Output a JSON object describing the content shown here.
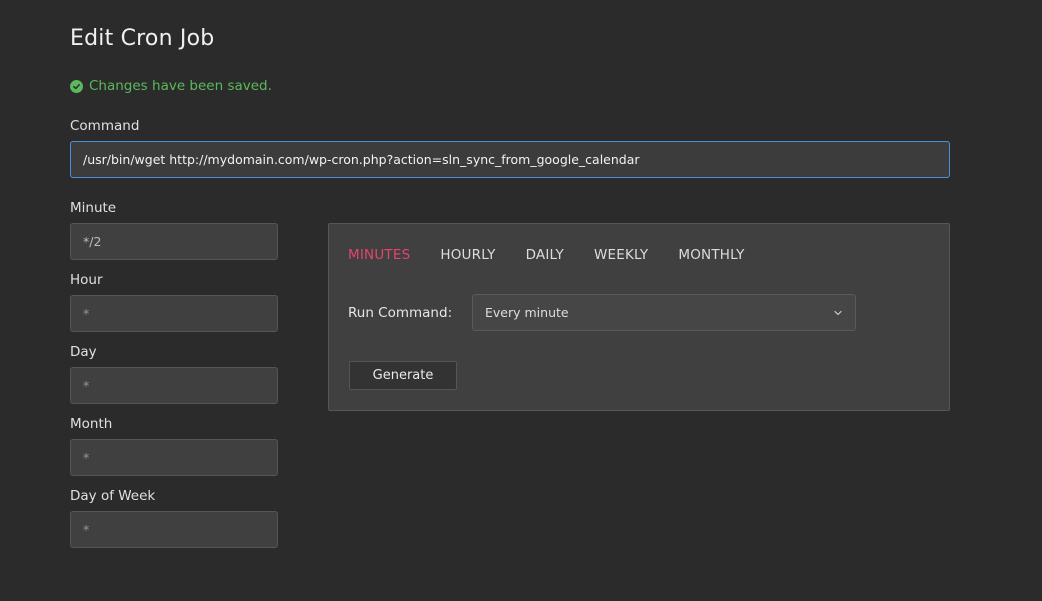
{
  "page": {
    "title": "Edit Cron Job"
  },
  "notice": {
    "text": "Changes have been saved.",
    "color": "#5cb85c",
    "icon": "check-circle-icon"
  },
  "command": {
    "label": "Command",
    "value": "/usr/bin/wget http://mydomain.com/wp-cron.php?action=sln_sync_from_google_calendar"
  },
  "fields": {
    "minute": {
      "label": "Minute",
      "value": "*/2"
    },
    "hour": {
      "label": "Hour",
      "placeholder": "*"
    },
    "day": {
      "label": "Day",
      "placeholder": "*"
    },
    "month": {
      "label": "Month",
      "placeholder": "*"
    },
    "day_of_week": {
      "label": "Day of Week",
      "placeholder": "*"
    }
  },
  "generator": {
    "tabs": [
      "MINUTES",
      "HOURLY",
      "DAILY",
      "WEEKLY",
      "MONTHLY"
    ],
    "active_tab": "MINUTES",
    "accent": "#e2456e",
    "run_label": "Run Command:",
    "select_value": "Every minute",
    "generate_label": "Generate"
  }
}
